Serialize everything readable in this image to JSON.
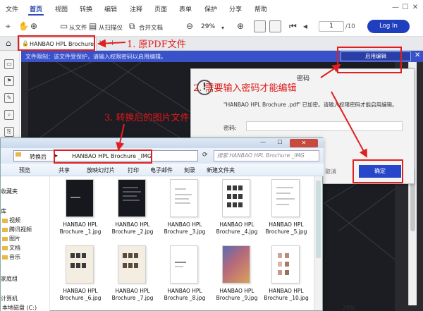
{
  "menu": {
    "items": [
      "文件",
      "首页",
      "视图",
      "转换",
      "编辑",
      "注释",
      "页面",
      "表单",
      "保护",
      "分享",
      "帮助"
    ],
    "active": "首页"
  },
  "toolbar": {
    "from_file": "从文件",
    "from_scanner": "从扫描仪",
    "merge_docs": "合并文档",
    "zoom": "29%",
    "page_current": "1",
    "page_total": "/10",
    "login": "Log In"
  },
  "tab": {
    "label": "HANBAO HPL Brochure"
  },
  "notice": {
    "text": "文件限制：该文件受保护，请输入权限密码以启用编辑。",
    "enable_edit": "启用编辑"
  },
  "dialog": {
    "title": "密码",
    "message": "\"HANBAO HPL Brochure .pdf\" 已加密。请输入权限密码才能启用编辑。",
    "password_label": "密码:",
    "cancel": "取消",
    "ok": "确定"
  },
  "explorer": {
    "path_parent": "转换后",
    "path_current": "HANBAO HPL Brochure _IMG",
    "search_placeholder": "搜索 HANBAO HPL Brochure _IMG",
    "commands": [
      "预览",
      "共享",
      "放映幻灯片",
      "打印",
      "电子邮件",
      "刻录",
      "新建文件夹"
    ],
    "nav": [
      "收藏夹",
      "库",
      "视频",
      "腾讯视频",
      "图片",
      "文档",
      "音乐",
      "家庭组",
      "计算机",
      "本地磁盘 (C:)"
    ],
    "files": [
      {
        "name": "HANBAO HPL Brochure _1.jpg",
        "style": "light"
      },
      {
        "name": "HANBAO HPL Brochure _2.jpg",
        "style": "dark"
      },
      {
        "name": "HANBAO HPL Brochure _3.jpg",
        "style": "light"
      },
      {
        "name": "HANBAO HPL Brochure _4.jpg",
        "style": "light"
      },
      {
        "name": "HANBAO HPL Brochure _5.jpg",
        "style": "light"
      },
      {
        "name": "HANBAO HPL Brochure _6.jpg",
        "style": "light"
      },
      {
        "name": "HANBAO HPL Brochure _7.jpg",
        "style": "light"
      },
      {
        "name": "HANBAO HPL Brochure _8.jpg",
        "style": "light"
      },
      {
        "name": "HANBAO HPL Brochure _9.jpg",
        "style": "colorful"
      },
      {
        "name": "HANBAO HPL Brochure _10.jpg",
        "style": "light"
      }
    ]
  },
  "annotations": {
    "a1": "1. 原PDF文件",
    "a2": "2. 需要输入密码才能编辑",
    "a3": "3. 转换后的图片文件"
  },
  "status": {
    "zoom": "29%"
  },
  "colors": {
    "accent": "#2d49c7",
    "annotation_red": "#e02020",
    "notice_bar": "#3a52c9"
  }
}
